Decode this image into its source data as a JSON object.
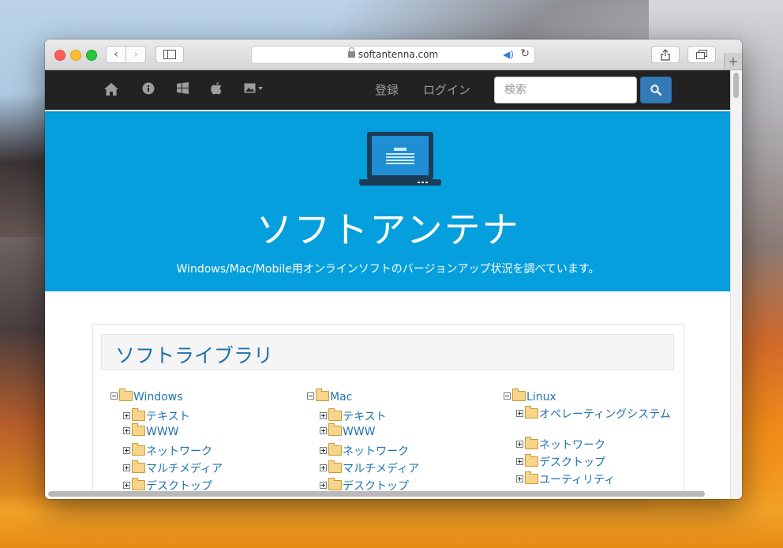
{
  "browser": {
    "url": "softantenna.com",
    "back_symbol": "‹",
    "forward_symbol": "›",
    "new_tab_symbol": "+"
  },
  "navbar": {
    "links": [
      "登録",
      "ログイン"
    ],
    "search_placeholder": "検索"
  },
  "hero": {
    "title": "ソフトアンテナ",
    "subtitle": "Windows/Mac/Mobile用オンラインソフトのバージョンアップ状況を調べています。"
  },
  "library": {
    "title": "ソフトライブラリ",
    "columns": [
      {
        "root": "Windows",
        "children": [
          "テキスト",
          "WWW",
          "ネットワーク",
          "マルチメディア",
          "デスクトップ"
        ]
      },
      {
        "root": "Mac",
        "children": [
          "テキスト",
          "WWW",
          "ネットワーク",
          "マルチメディア",
          "デスクトップ"
        ]
      },
      {
        "root": "Linux",
        "children": [
          "オペレーティングシステム",
          "ネットワーク",
          "デスクトップ",
          "ユーティリティ"
        ]
      }
    ]
  }
}
